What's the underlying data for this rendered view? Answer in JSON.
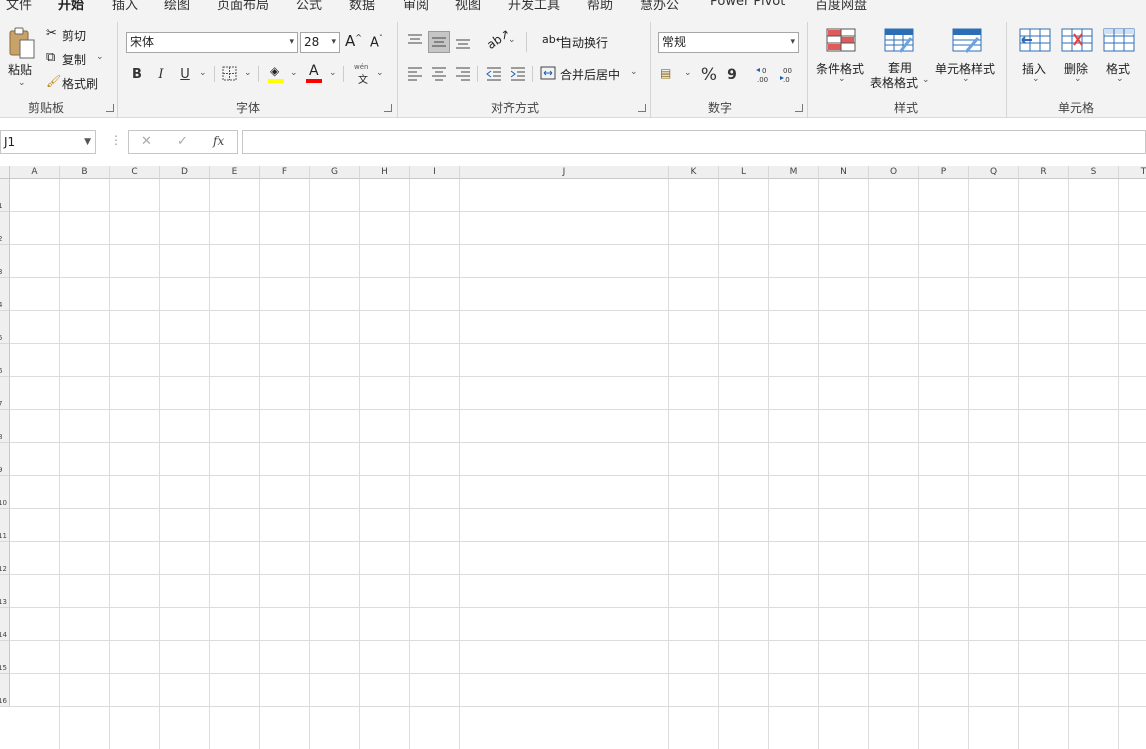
{
  "tabs": [
    "文件",
    "开始",
    "插入",
    "绘图",
    "页面布局",
    "公式",
    "数据",
    "审阅",
    "视图",
    "开发工具",
    "帮助",
    "慧办公",
    "Power Pivot",
    "百度网盘"
  ],
  "active_tab": "开始",
  "clipboard": {
    "paste": "粘贴",
    "cut": "剪切",
    "copy": "复制",
    "format_painter": "格式刷",
    "label": "剪贴板"
  },
  "font": {
    "name": "宋体",
    "size": "28",
    "grow": "A",
    "shrink": "A",
    "bold": "B",
    "italic": "I",
    "underline": "U",
    "color_letter": "A",
    "phonetic": "wén",
    "phonetic_char": "文",
    "label": "字体",
    "fill_color": "#ffff00",
    "font_color": "#ff0000"
  },
  "alignment": {
    "wrap": "自动换行",
    "merge": "合并后居中",
    "label": "对齐方式"
  },
  "number": {
    "format": "常规",
    "percent": "%",
    "comma": "9",
    "label": "数字"
  },
  "styles": {
    "conditional": "条件格式",
    "table_line1": "套用",
    "table_line2": "表格格式",
    "cell_styles": "单元格样式",
    "label": "样式"
  },
  "cells": {
    "insert": "插入",
    "delete": "删除",
    "format": "格式",
    "label": "单元格"
  },
  "formula_bar": {
    "name_box": "J1",
    "cancel": "✕",
    "enter": "✓",
    "fx": "fx",
    "value": ""
  },
  "columns": [
    "A",
    "B",
    "C",
    "D",
    "E",
    "F",
    "G",
    "H",
    "I",
    "J",
    "K",
    "L",
    "M",
    "N",
    "O",
    "P",
    "Q",
    "R",
    "S",
    "T"
  ],
  "rows": [
    "1",
    "2",
    "3",
    "4",
    "5",
    "6",
    "7",
    "8",
    "9",
    "10",
    "11",
    "12",
    "13",
    "14",
    "15",
    "16"
  ],
  "accent": "#217346"
}
